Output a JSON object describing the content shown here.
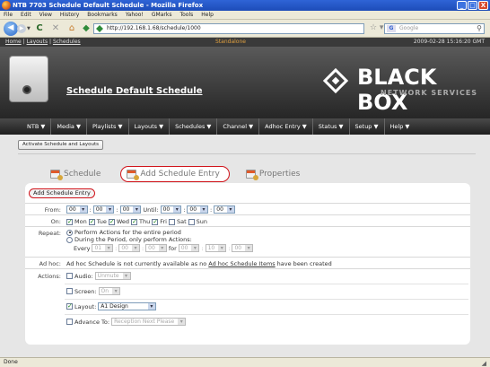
{
  "window": {
    "title": "NTB 7703 Schedule Default Schedule - Mozilla Firefox",
    "buttons": {
      "minimize": "_",
      "maximize": "□",
      "close": "X"
    }
  },
  "browser_menu": [
    "File",
    "Edit",
    "View",
    "History",
    "Bookmarks",
    "Yahoo!",
    "GMarks",
    "Tools",
    "Help"
  ],
  "browser": {
    "url": "http://192.168.1.68/schedule/1000",
    "search_placeholder": "Google",
    "status": "Done"
  },
  "page": {
    "breadcrumb": [
      "Home",
      "Layouts",
      "Schedules"
    ],
    "breadcrumb_sep": " | ",
    "mode": "Standalone",
    "datetime": "2009-02-28 15:16:20 GMT",
    "heading": "Schedule Default Schedule",
    "logo": {
      "line1": "BLACK BOX",
      "line2": "NETWORK SERVICES"
    },
    "nav": [
      "NTB ▼",
      "Media ▼",
      "Playlists ▼",
      "Layouts ▼",
      "Schedules ▼",
      "Channel ▼",
      "Adhoc Entry ▼",
      "Status ▼",
      "Setup ▼",
      "Help ▼"
    ],
    "activate_button": "Activate Schedule and Layouts",
    "tabs": [
      "Schedule",
      "Add Schedule Entry",
      "Properties"
    ],
    "panel_title": "Add Schedule Entry",
    "from": {
      "label": "From:",
      "h": "00",
      "m": "00",
      "s": "00",
      "until_label": "Until:",
      "uh": "00",
      "um": "00",
      "us": "00",
      "colon": ":"
    },
    "on": {
      "label": "On:",
      "days": [
        {
          "name": "Mon",
          "checked": true
        },
        {
          "name": "Tue",
          "checked": true
        },
        {
          "name": "Wed",
          "checked": true
        },
        {
          "name": "Thu",
          "checked": true
        },
        {
          "name": "Fri",
          "checked": true
        },
        {
          "name": "Sat",
          "checked": false
        },
        {
          "name": "Sun",
          "checked": false
        }
      ]
    },
    "repeat": {
      "label": "Repeat:",
      "option1": "Perform Actions for the entire period",
      "option2": "During the Period, only perform Actions:",
      "every_label": "Every",
      "every_h": "01",
      "every_m": "00",
      "every_s": "00",
      "for_label": "for",
      "for_h": "00",
      "for_m": "10",
      "for_s": "00"
    },
    "adhoc": {
      "label": "Ad hoc:",
      "text_before": "Ad hoc Schedule is not currently available as no",
      "link": "Ad hoc Schedule Items",
      "text_after": "have been created"
    },
    "actions": {
      "label": "Actions:",
      "audio_label": "Audio:",
      "audio_value": "Unmute",
      "screen_label": "Screen:",
      "screen_value": "On",
      "layout_label": "Layout:",
      "layout_value": "A1 Design",
      "advance_label": "Advance To:",
      "advance_value": "Reception Next Please"
    }
  }
}
